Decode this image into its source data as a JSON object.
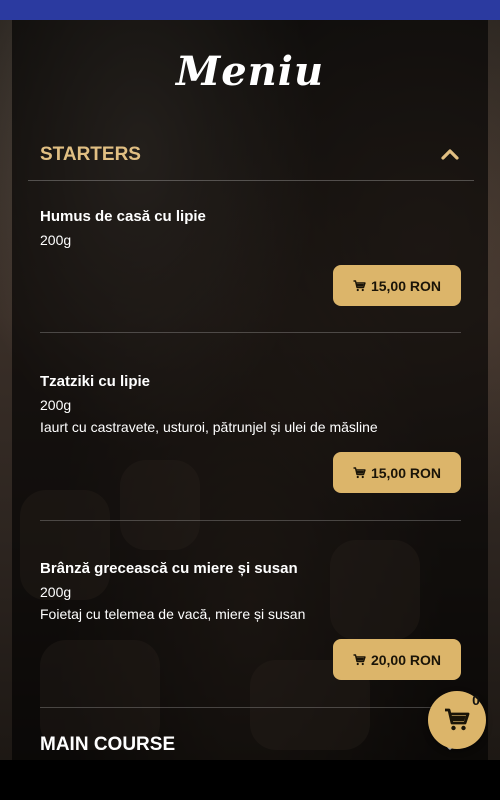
{
  "menu": {
    "title": "Meniu"
  },
  "sections": [
    {
      "label": "STARTERS",
      "expanded": true
    },
    {
      "label": "MAIN COURSE",
      "expanded": false
    }
  ],
  "items": [
    {
      "name": "Humus de casă cu lipie",
      "weight": "200g",
      "description": "",
      "price": "15,00 RON"
    },
    {
      "name": "Tzatziki cu lipie",
      "weight": "200g",
      "description": "Iaurt cu castravete, usturoi, pătrunjel și ulei de măsline",
      "price": "15,00 RON"
    },
    {
      "name": "Brânză grecească cu miere și susan",
      "weight": "200g",
      "description": "Foietaj cu telemea de vacă, miere și susan",
      "price": "20,00 RON"
    }
  ],
  "cart": {
    "count": "0",
    "icon": "cart-icon"
  },
  "colors": {
    "accent": "#dcb56a",
    "section_active": "#e1bf83",
    "status_bar": "#2b3aa0"
  }
}
